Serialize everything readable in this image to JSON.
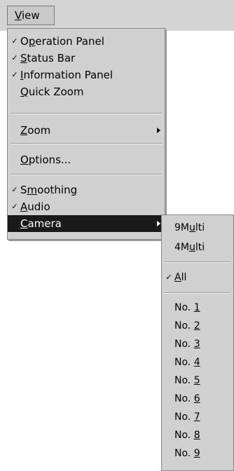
{
  "menubar": {
    "title": {
      "u": "V",
      "rest": "iew"
    }
  },
  "view_menu": {
    "items": [
      {
        "pre": "O",
        "u": "p",
        "post": "eration Panel",
        "checked": true
      },
      {
        "pre": "",
        "u": "S",
        "post": "tatus Bar",
        "checked": true
      },
      {
        "pre": "",
        "u": "I",
        "post": "nformation Panel",
        "checked": true
      },
      {
        "pre": "",
        "u": "Q",
        "post": "uick Zoom",
        "checked": false
      },
      {
        "pre": "",
        "u": "Z",
        "post": "oom",
        "checked": false,
        "submenu": true
      },
      {
        "pre": "",
        "u": "O",
        "post": "ptions...",
        "checked": false
      },
      {
        "pre": "S",
        "u": "m",
        "post": "oothing",
        "checked": true
      },
      {
        "pre": "",
        "u": "A",
        "post": "udio",
        "checked": true
      },
      {
        "pre": "",
        "u": "C",
        "post": "amera",
        "checked": false,
        "submenu": true,
        "selected": true
      }
    ],
    "check_glyph": "✓"
  },
  "camera_submenu": {
    "multi": [
      {
        "pre": "9M",
        "u": "u",
        "post": "lti"
      },
      {
        "pre": "4M",
        "u": "u",
        "post": "lti"
      }
    ],
    "all": {
      "pre": "",
      "u": "A",
      "post": "ll",
      "checked": true
    },
    "numbers": [
      {
        "pre": "No. ",
        "u": "1"
      },
      {
        "pre": "No. ",
        "u": "2"
      },
      {
        "pre": "No. ",
        "u": "3"
      },
      {
        "pre": "No. ",
        "u": "4"
      },
      {
        "pre": "No. ",
        "u": "5"
      },
      {
        "pre": "No. ",
        "u": "6"
      },
      {
        "pre": "No. ",
        "u": "7"
      },
      {
        "pre": "No. ",
        "u": "8"
      },
      {
        "pre": "No. ",
        "u": "9"
      }
    ]
  }
}
